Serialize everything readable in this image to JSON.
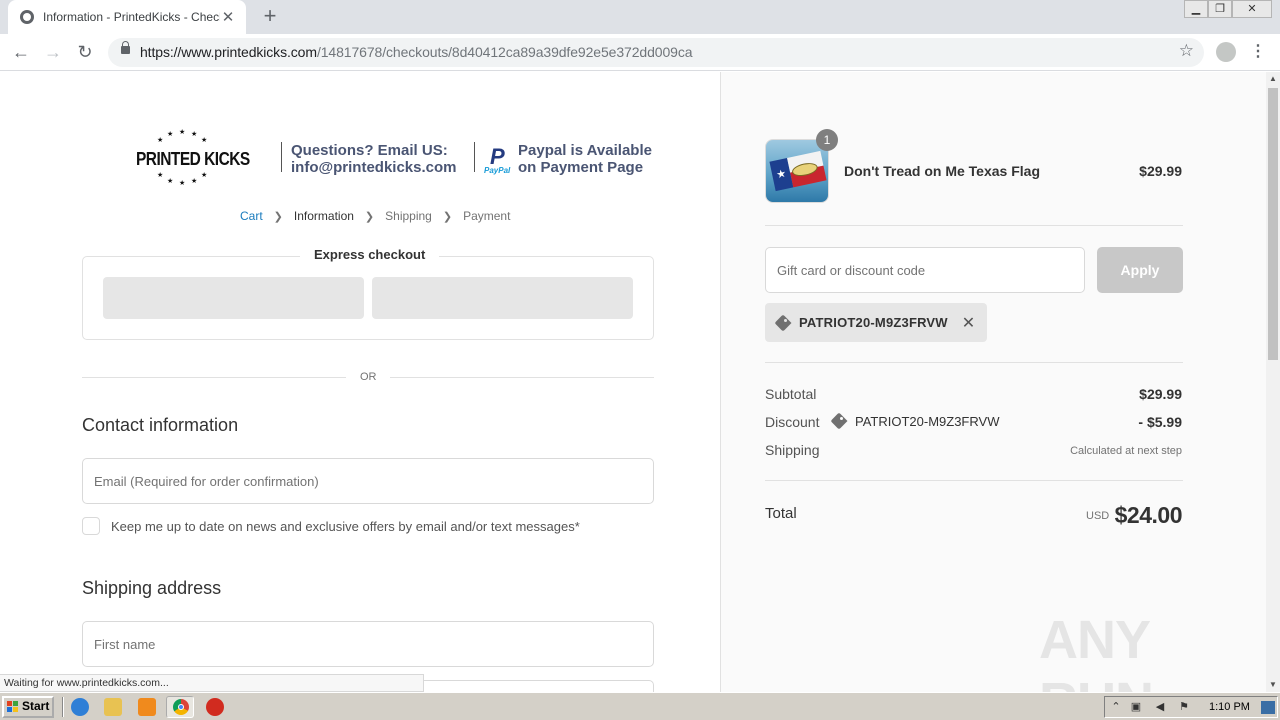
{
  "browser": {
    "tab_title": "Information - PrintedKicks - Checkout",
    "url_domain": "https://www.printedkicks.com",
    "url_path": "/14817678/checkouts/8d40412ca89a39dfe92e5e372dd009ca",
    "status_text": "Waiting for www.printedkicks.com..."
  },
  "header": {
    "logo_text": "PRINTED KICKS",
    "question_line1": "Questions? Email US:",
    "question_line2": "info@printedkicks.com",
    "paypal_logo_word": "PayPal",
    "paypal_line1": "Paypal is Available",
    "paypal_line2": "on Payment Page"
  },
  "breadcrumb": {
    "cart": "Cart",
    "information": "Information",
    "shipping": "Shipping",
    "payment": "Payment",
    "separator": ">"
  },
  "express": {
    "title": "Express checkout",
    "or_text": "OR"
  },
  "contact": {
    "title": "Contact information",
    "email_placeholder": "Email (Required for order confirmation)",
    "newsletter_label": "Keep me up to date on news and exclusive offers by email and/or text messages*"
  },
  "shipping_address": {
    "title": "Shipping address",
    "first_name_placeholder": "First name"
  },
  "order_summary": {
    "product": {
      "name": "Don't Tread on Me Texas Flag",
      "price": "$29.99",
      "quantity": "1"
    },
    "discount_input_placeholder": "Gift card or discount code",
    "apply_label": "Apply",
    "applied_code": "PATRIOT20-M9Z3FRVW",
    "subtotal_label": "Subtotal",
    "subtotal_value": "$29.99",
    "discount_label": "Discount",
    "discount_code": "PATRIOT20-M9Z3FRVW",
    "discount_value": "- $5.99",
    "shipping_label": "Shipping",
    "shipping_value": "Calculated at next step",
    "total_label": "Total",
    "total_currency": "USD",
    "total_value": "$24.00"
  },
  "watermark": "ANY RUN",
  "taskbar": {
    "start_label": "Start",
    "clock": "1:10 PM"
  },
  "colors": {
    "link_blue": "#197bbd",
    "banner_text": "#4a5573",
    "apply_disabled": "#c8c8c8",
    "sidebar_bg": "#fafafa"
  }
}
